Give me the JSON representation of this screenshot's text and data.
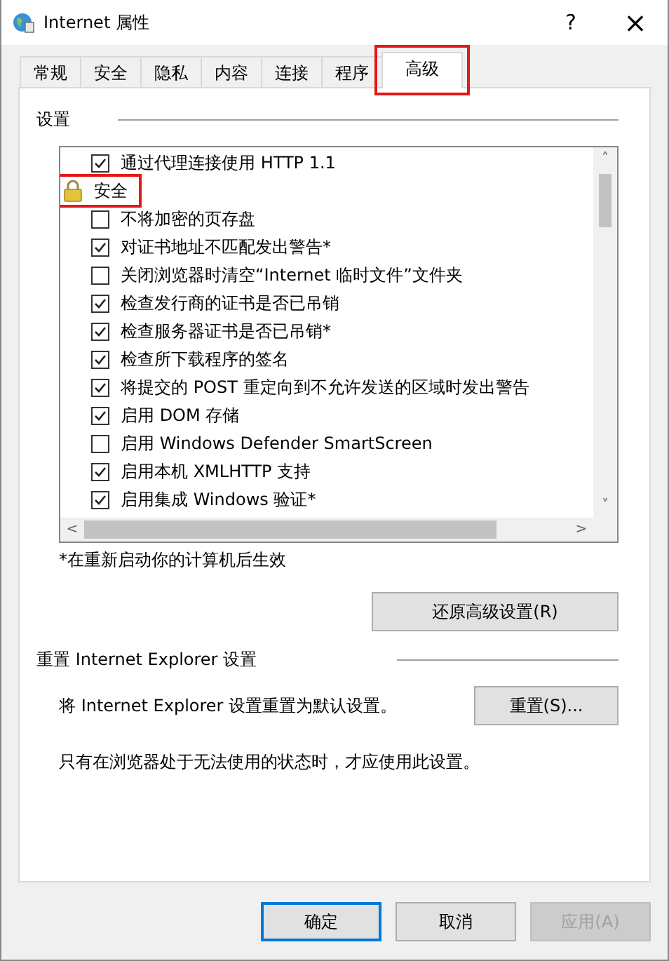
{
  "window": {
    "title": "Internet 属性",
    "help": "?",
    "close": "×"
  },
  "tabs": [
    {
      "label": "常规",
      "selected": false,
      "highlighted": false
    },
    {
      "label": "安全",
      "selected": false,
      "highlighted": false
    },
    {
      "label": "隐私",
      "selected": false,
      "highlighted": false
    },
    {
      "label": "内容",
      "selected": false,
      "highlighted": false
    },
    {
      "label": "连接",
      "selected": false,
      "highlighted": false
    },
    {
      "label": "程序",
      "selected": false,
      "highlighted": false
    },
    {
      "label": "高级",
      "selected": true,
      "highlighted": true
    }
  ],
  "settings": {
    "title": "设置",
    "items": [
      {
        "kind": "checkbox",
        "label": "通过代理连接使用 HTTP 1.1",
        "checked": true,
        "highlighted": false
      },
      {
        "kind": "header",
        "label": "安全",
        "highlighted": true
      },
      {
        "kind": "checkbox",
        "label": "不将加密的页存盘",
        "checked": false,
        "highlighted": false
      },
      {
        "kind": "checkbox",
        "label": "对证书地址不匹配发出警告*",
        "checked": true,
        "highlighted": false
      },
      {
        "kind": "checkbox",
        "label": "关闭浏览器时清空“Internet 临时文件”文件夹",
        "checked": false,
        "highlighted": false
      },
      {
        "kind": "checkbox",
        "label": "检查发行商的证书是否已吊销",
        "checked": true,
        "highlighted": false
      },
      {
        "kind": "checkbox",
        "label": "检查服务器证书是否已吊销*",
        "checked": true,
        "highlighted": false
      },
      {
        "kind": "checkbox",
        "label": "检查所下载程序的签名",
        "checked": true,
        "highlighted": false
      },
      {
        "kind": "checkbox",
        "label": "将提交的 POST 重定向到不允许发送的区域时发出警告",
        "checked": true,
        "highlighted": false
      },
      {
        "kind": "checkbox",
        "label": "启用 DOM 存储",
        "checked": true,
        "highlighted": false
      },
      {
        "kind": "checkbox",
        "label": "启用 Windows Defender SmartScreen",
        "checked": false,
        "highlighted": false
      },
      {
        "kind": "checkbox",
        "label": "启用本机 XMLHTTP 支持",
        "checked": true,
        "highlighted": false
      },
      {
        "kind": "checkbox",
        "label": "启用集成 Windows 验证*",
        "checked": true,
        "highlighted": false
      }
    ],
    "scroll_up": "˄",
    "scroll_down": "˅",
    "scroll_left": "<",
    "scroll_right": ">",
    "note": "*在重新启动你的计算机后生效",
    "restore_button": "还原高级设置(R)"
  },
  "reset": {
    "title": "重置 Internet Explorer 设置",
    "description": "将 Internet Explorer 设置重置为默认设置。",
    "button": "重置(S)...",
    "hint": "只有在浏览器处于无法使用的状态时，才应使用此设置。"
  },
  "buttons": [
    {
      "label": "确定",
      "default": true,
      "disabled": false
    },
    {
      "label": "取消",
      "default": false,
      "disabled": false
    },
    {
      "label": "应用(A)",
      "default": false,
      "disabled": true
    }
  ]
}
